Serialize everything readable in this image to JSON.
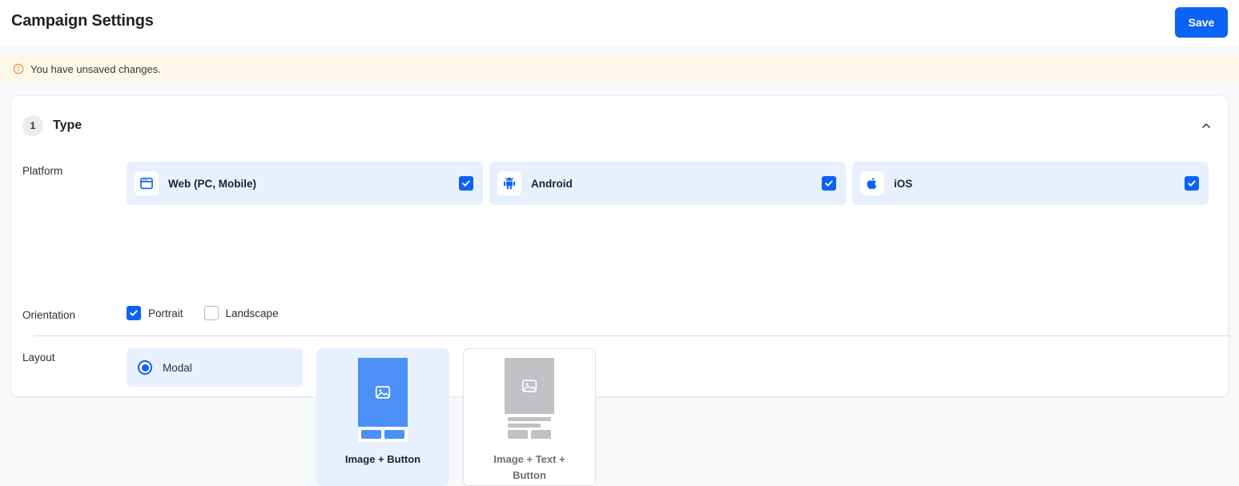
{
  "header": {
    "title": "Campaign Settings",
    "save_label": "Save"
  },
  "alert": {
    "icon": "alert-circle-icon",
    "message": "You have unsaved changes."
  },
  "section": {
    "step_number": "1",
    "title": "Type",
    "collapse_icon": "chevron-up-icon"
  },
  "platform": {
    "label": "Platform",
    "options": [
      {
        "label": "Web (PC, Mobile)",
        "icon": "browser-window-icon",
        "checked": true
      },
      {
        "label": "Android",
        "icon": "android-icon",
        "checked": true
      },
      {
        "label": "iOS",
        "icon": "apple-icon",
        "checked": true
      }
    ]
  },
  "orientation": {
    "label": "Orientation",
    "options": [
      {
        "label": "Portrait",
        "checked": true
      },
      {
        "label": "Landscape",
        "checked": false
      }
    ]
  },
  "layout": {
    "label": "Layout",
    "modal_option": {
      "label": "Modal",
      "selected": true
    },
    "cards": [
      {
        "label": "Image + Button",
        "selected": true
      },
      {
        "label": "Image + Text + Button",
        "selected": false
      }
    ]
  },
  "colors": {
    "accent": "#0b62f5",
    "card_selected_bg": "#e8f0fe",
    "alert_bg": "#fdf7e7",
    "alert_icon": "#e8883a",
    "page_bg": "#f7f8f9"
  }
}
